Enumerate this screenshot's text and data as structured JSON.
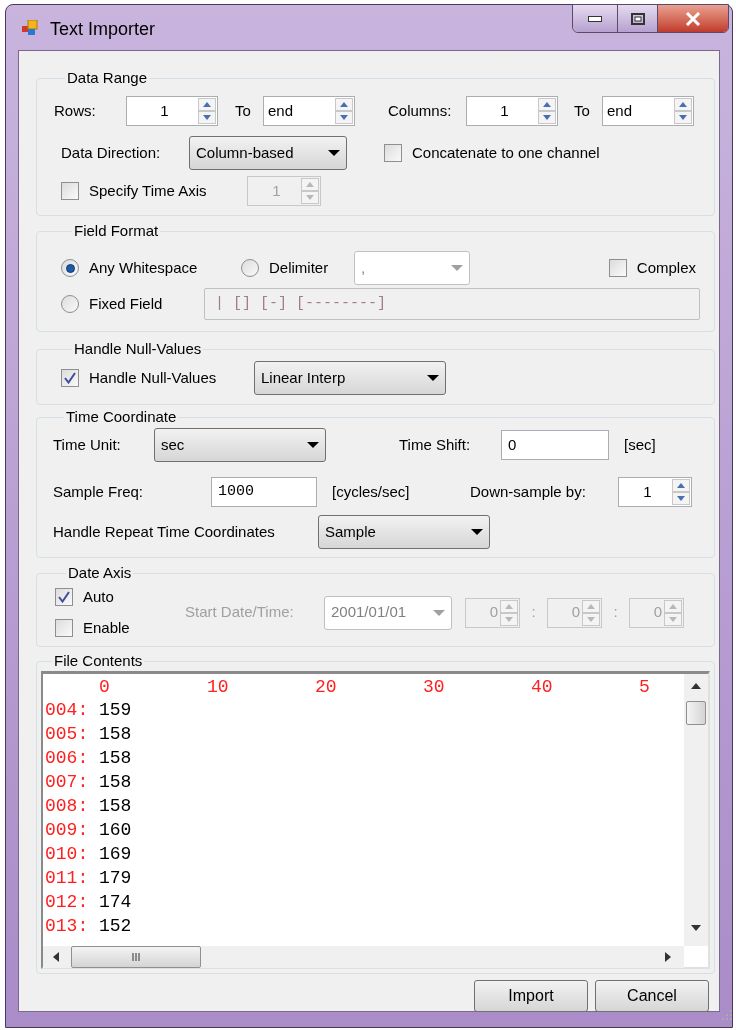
{
  "window": {
    "title": "Text Importer"
  },
  "data_range": {
    "title": "Data Range",
    "rows_label": "Rows:",
    "rows_from": "1",
    "rows_to_label": "To",
    "rows_to": "end",
    "columns_label": "Columns:",
    "columns_from": "1",
    "columns_to_label": "To",
    "columns_to": "end",
    "direction_label": "Data Direction:",
    "direction": "Column-based",
    "concatenate": {
      "label": "Concatenate to one channel",
      "checked": false
    },
    "specify_time_axis": {
      "label": "Specify Time Axis",
      "checked": false
    },
    "time_axis": {
      "value": "1",
      "disabled": true
    }
  },
  "field_format": {
    "title": "Field Format",
    "options": [
      {
        "label": "Any Whitespace",
        "selected": true
      },
      {
        "label": "Delimiter",
        "selected": false
      },
      {
        "label": "Fixed Field",
        "selected": false
      }
    ],
    "delimiter": {
      "value": ",",
      "disabled": true
    },
    "complex": {
      "label": "Complex",
      "checked": false
    },
    "fixed_field_pattern": "| [] [-] [--------]"
  },
  "handle_null_values": {
    "title": "Handle Null-Values",
    "checkbox": {
      "label": "Handle Null-Values",
      "checked": true
    },
    "method": "Linear Interp"
  },
  "time_coordinate": {
    "title": "Time Coordinate",
    "time_unit_label": "Time Unit:",
    "time_unit": "sec",
    "time_shift_label": "Time Shift:",
    "time_shift": "0",
    "time_shift_unit": "[sec]",
    "sample_freq_label": "Sample Freq:",
    "sample_freq": "1000",
    "sample_freq_unit": "[cycles/sec]",
    "downsample_label": "Down-sample by:",
    "downsample": "1",
    "repeat_label": "Handle Repeat Time Coordinates",
    "repeat": "Sample"
  },
  "date_axis": {
    "title": "Date Axis",
    "auto": {
      "label": "Auto",
      "checked": true
    },
    "enable": {
      "label": "Enable",
      "checked": false
    },
    "start_label": "Start Date/Time:",
    "start_date": "2001/01/01",
    "disabled": true,
    "time_fields": [
      {
        "value": "0"
      },
      {
        "separator": ":",
        "value": "0"
      },
      {
        "separator": ":",
        "value": "0"
      }
    ]
  },
  "file_contents": {
    "title": "File Contents",
    "ruler": [
      "0",
      "10",
      "20",
      "30",
      "40",
      "5"
    ],
    "lines": [
      {
        "number": "004:",
        "value": "159"
      },
      {
        "number": "005:",
        "value": "158"
      },
      {
        "number": "006:",
        "value": "158"
      },
      {
        "number": "007:",
        "value": "158"
      },
      {
        "number": "008:",
        "value": "158"
      },
      {
        "number": "009:",
        "value": "160"
      },
      {
        "number": "010:",
        "value": "169"
      },
      {
        "number": "011:",
        "value": "179"
      },
      {
        "number": "012:",
        "value": "174"
      },
      {
        "number": "013:",
        "value": "152"
      }
    ]
  },
  "buttons": [
    "Import",
    "Cancel"
  ]
}
